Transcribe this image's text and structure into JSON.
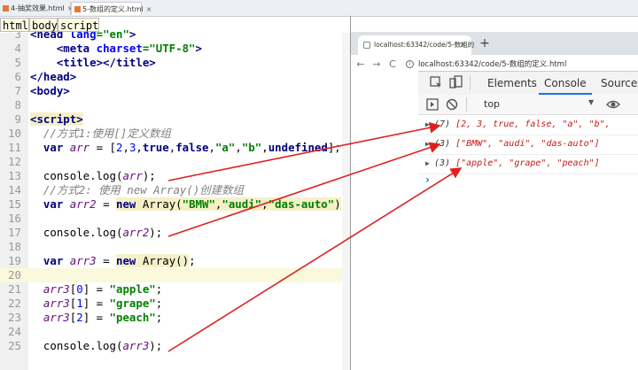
{
  "editor_tabs": [
    {
      "label": "4-抽奖效果.html",
      "close": "×"
    },
    {
      "label": "5-数组的定义.html",
      "close": "×"
    }
  ],
  "breadcrumb": [
    "html",
    "body",
    "script"
  ],
  "code_lines": [
    {
      "n": "3",
      "text": "<head lang=\"en\">"
    },
    {
      "n": "4",
      "text": "<meta charset=\"UTF-8\">"
    },
    {
      "n": "5",
      "text": "<title></title>"
    },
    {
      "n": "6",
      "text": "</head>"
    },
    {
      "n": "7",
      "text": "<body>"
    },
    {
      "n": "8",
      "text": ""
    },
    {
      "n": "9",
      "text": "<script>"
    },
    {
      "n": "10",
      "text": "//方式1:使用[]定义数组"
    },
    {
      "n": "11",
      "text": "var arr = [2,3,true,false,\"a\",\"b\",undefined];"
    },
    {
      "n": "12",
      "text": ""
    },
    {
      "n": "13",
      "text": "console.log(arr);"
    },
    {
      "n": "14",
      "text": "//方式2: 使用 new Array()创建数组"
    },
    {
      "n": "15",
      "text": "var arr2 = new Array(\"BMW\",\"audi\",\"das-auto\");"
    },
    {
      "n": "16",
      "text": ""
    },
    {
      "n": "17",
      "text": "console.log(arr2);"
    },
    {
      "n": "18",
      "text": ""
    },
    {
      "n": "19",
      "text": "var arr3 = new Array();"
    },
    {
      "n": "20",
      "text": ""
    },
    {
      "n": "21",
      "text": "arr3[0] = \"apple\";"
    },
    {
      "n": "22",
      "text": "arr3[1] = \"grape\";"
    },
    {
      "n": "23",
      "text": "arr3[2] = \"peach\";"
    },
    {
      "n": "24",
      "text": ""
    },
    {
      "n": "25",
      "text": "console.log(arr3);"
    }
  ],
  "browser": {
    "tab_title": "localhost:63342/code/5-数组的",
    "tab_close": "×",
    "new_tab": "+",
    "url": "localhost:63342/code/5-数组的定义.html",
    "back": "←",
    "forward": "→",
    "reload": "C",
    "info": "i"
  },
  "devtools": {
    "tabs": [
      "Elements",
      "Console",
      "Sources"
    ],
    "active_tab": "Console",
    "context": "top",
    "context_dropdown": "▼",
    "prompt": "›",
    "output": [
      {
        "count": "(7)",
        "value": "[2, 3, true, false, \"a\", \"b\","
      },
      {
        "count": "(3)",
        "value": "[\"BMW\", \"audi\", \"das-auto\"]"
      },
      {
        "count": "(3)",
        "value": "[\"apple\", \"grape\", \"peach\"]"
      }
    ]
  },
  "colors": {
    "arrow": "#e02020",
    "accent": "#1a73e8"
  }
}
